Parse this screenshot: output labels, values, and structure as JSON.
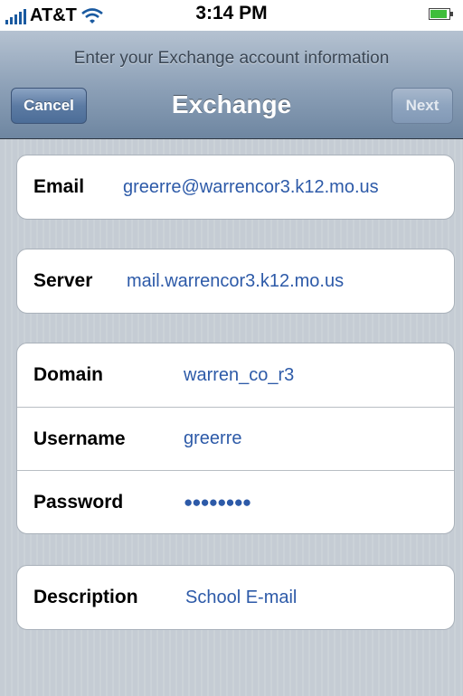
{
  "status_bar": {
    "carrier": "AT&T",
    "time": "3:14 PM",
    "signal_icon": "signal-bars-icon",
    "wifi_icon": "wifi-icon",
    "battery_icon": "battery-icon"
  },
  "nav": {
    "prompt": "Enter your Exchange account information",
    "title": "Exchange",
    "cancel_label": "Cancel",
    "next_label": "Next"
  },
  "form": {
    "email": {
      "label": "Email",
      "value": "greerre@warrencor3.k12.mo.us"
    },
    "server": {
      "label": "Server",
      "value": "mail.warrencor3.k12.mo.us"
    },
    "domain": {
      "label": "Domain",
      "value": "warren_co_r3"
    },
    "username": {
      "label": "Username",
      "value": "greerre"
    },
    "password": {
      "label": "Password",
      "value": "●●●●●●●●"
    },
    "description": {
      "label": "Description",
      "value": "School E-mail"
    }
  },
  "colors": {
    "value_text": "#2d5aa8",
    "nav_bar": "#8b9fb6",
    "background": "#c5ccd4"
  }
}
